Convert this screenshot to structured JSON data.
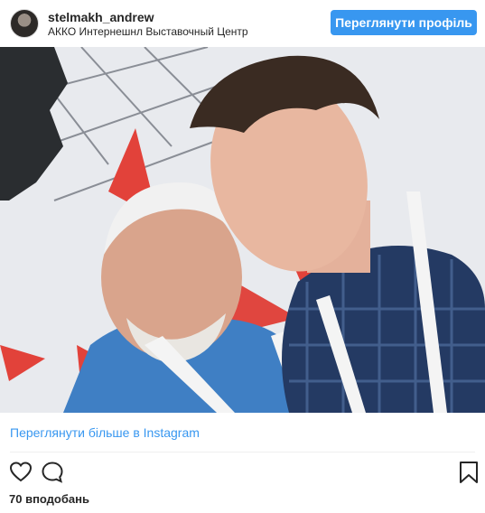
{
  "header": {
    "username": "stelmakh_andrew",
    "location": "АККО Интернешнл Выставочный Центр",
    "profile_button": "Переглянути профіль"
  },
  "post": {
    "photo": "selfie-photo",
    "view_more_label": "Переглянути більше в Instagram",
    "likes": "70 вподобань"
  },
  "icons": {
    "like": "heart-icon",
    "comment": "comment-icon",
    "save": "bookmark-icon"
  },
  "colors": {
    "accent": "#3897f0",
    "text": "#262626"
  }
}
